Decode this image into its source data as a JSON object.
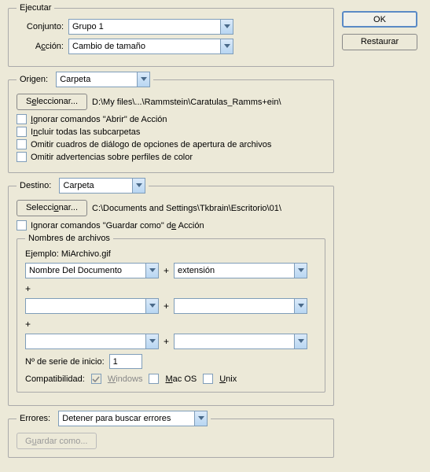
{
  "buttons": {
    "ok": "OK",
    "restore": "Restaurar",
    "select": "Seleccionar...",
    "saveAs": "Guardar como..."
  },
  "ejecutar": {
    "legend": "Ejecutar",
    "conjuntoLabel": "Conjunto:",
    "conjuntoValue": "Grupo 1",
    "accionLabel": "Acción:",
    "accionValue": "Cambio de tamaño"
  },
  "origen": {
    "legend": "Origen:",
    "value": "Carpeta",
    "path": "D:\\My files\\...\\Rammstein\\Caratulas_Ramms+ein\\",
    "chk1": "Ignorar comandos \"Abrir\" de Acción",
    "chk2": "Incluir todas las subcarpetas",
    "chk3": "Omitir cuadros de diálogo de opciones de apertura de archivos",
    "chk4": "Omitir advertencias sobre perfiles de color"
  },
  "destino": {
    "legend": "Destino:",
    "value": "Carpeta",
    "path": "C:\\Documents and Settings\\Tkbrain\\Escritorio\\01\\",
    "chk1": "Ignorar comandos \"Guardar como\" de Acción"
  },
  "nombres": {
    "legend": "Nombres de archivos",
    "ejemplo": "Ejemplo: MiArchivo.gif",
    "f1": "Nombre Del Documento",
    "f2": "extensión",
    "serialLabel": "Nº de serie de inicio:",
    "serialValue": "1",
    "compatLabel": "Compatibilidad:",
    "win": "Windows",
    "mac": "Mac OS",
    "unix": "Unix"
  },
  "errores": {
    "legend": "Errores:",
    "value": "Detener para buscar errores"
  }
}
